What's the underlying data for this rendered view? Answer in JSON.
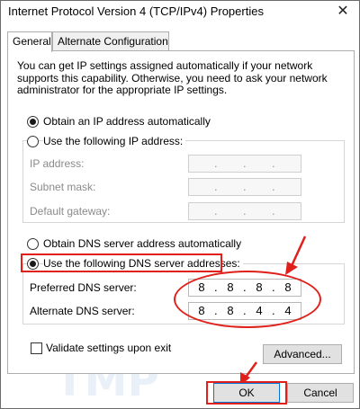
{
  "window": {
    "title": "Internet Protocol Version 4 (TCP/IPv4) Properties",
    "close_glyph": "✕"
  },
  "tabs": [
    {
      "label": "General",
      "active": true
    },
    {
      "label": "Alternate Configuration",
      "active": false
    }
  ],
  "description": "You can get IP settings assigned automatically if your network supports this capability. Otherwise, you need to ask your network administrator for the appropriate IP settings.",
  "ip_section": {
    "auto_label": "Obtain an IP address automatically",
    "auto_selected": true,
    "manual_label": "Use the following IP address:",
    "manual_selected": false,
    "fields": [
      {
        "label": "IP address:",
        "octets": [
          "",
          "",
          "",
          ""
        ]
      },
      {
        "label": "Subnet mask:",
        "octets": [
          "",
          "",
          "",
          ""
        ]
      },
      {
        "label": "Default gateway:",
        "octets": [
          "",
          "",
          "",
          ""
        ]
      }
    ]
  },
  "dns_section": {
    "auto_label": "Obtain DNS server address automatically",
    "auto_selected": false,
    "manual_label": "Use the following DNS server addresses:",
    "manual_selected": true,
    "preferred": {
      "label": "Preferred DNS server:",
      "octets": [
        "8",
        "8",
        "8",
        "8"
      ]
    },
    "alternate": {
      "label": "Alternate DNS server:",
      "octets": [
        "8",
        "8",
        "4",
        "4"
      ]
    }
  },
  "validate": {
    "label": "Validate settings upon exit",
    "checked": false
  },
  "buttons": {
    "advanced": "Advanced...",
    "ok": "OK",
    "cancel": "Cancel"
  },
  "annotation_color": "#e0201a"
}
